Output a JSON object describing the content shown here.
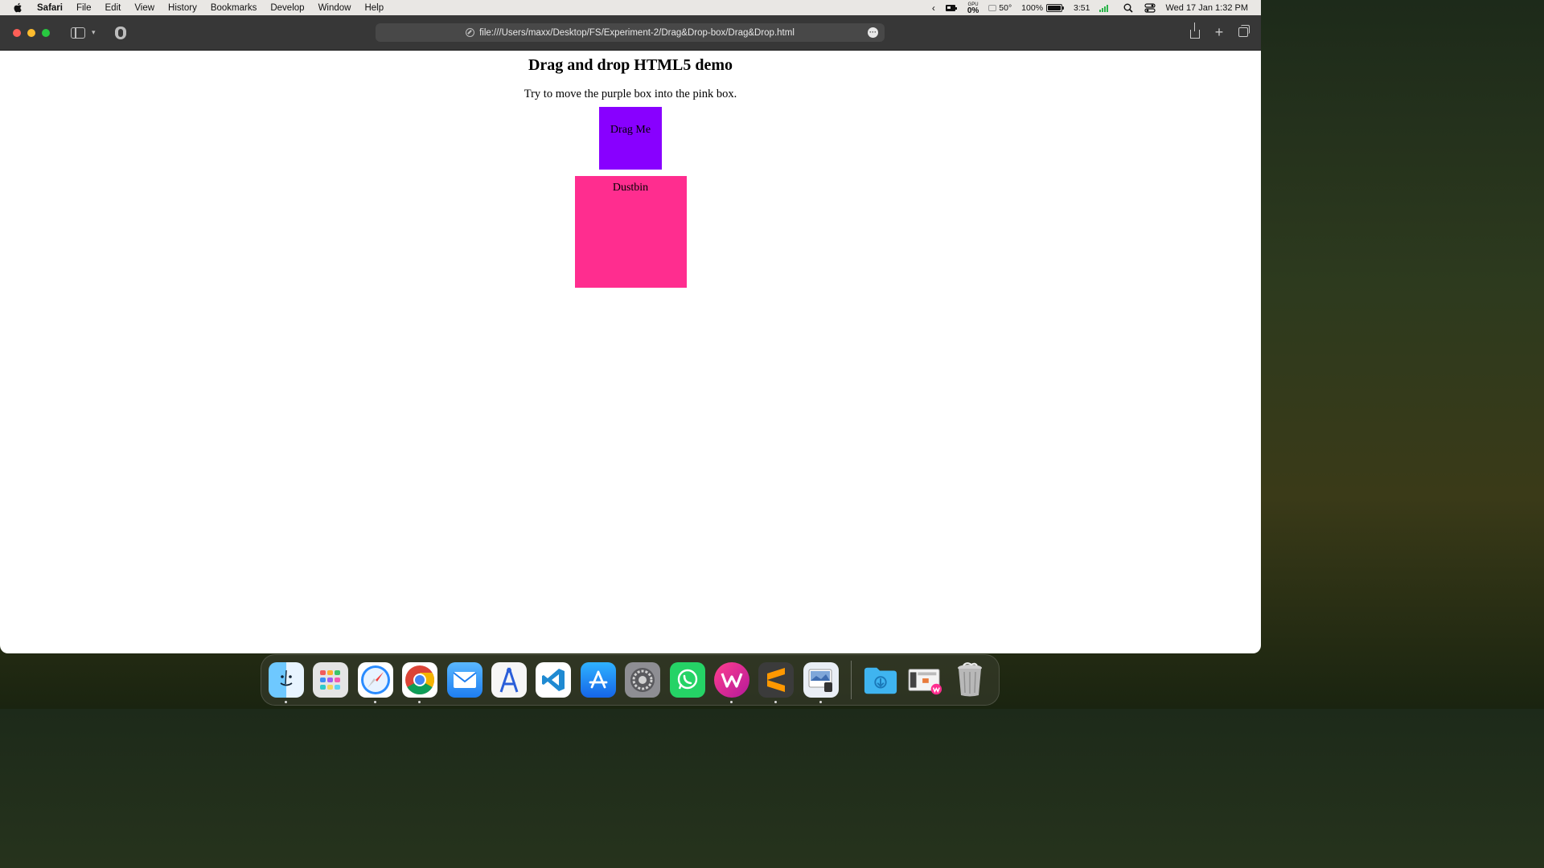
{
  "menubar": {
    "app_name": "Safari",
    "menus": [
      "File",
      "Edit",
      "View",
      "History",
      "Bookmarks",
      "Develop",
      "Window",
      "Help"
    ],
    "gpu_label": "GPU",
    "gpu_value": "0%",
    "temperature": "50°",
    "battery_percent": "100%",
    "battery_level": 1.0,
    "time_remaining": "3:51",
    "datetime": "Wed 17 Jan  1:32 PM"
  },
  "browser": {
    "url": "file:///Users/maxx/Desktop/FS/Experiment-2/Drag&Drop-box/Drag&Drop.html"
  },
  "page": {
    "title": "Drag and drop HTML5 demo",
    "instructions": "Try to move the purple box into the pink box.",
    "drag_box_label": "Drag Me",
    "drop_zone_label": "Dustbin",
    "colors": {
      "drag_box": "#8800ff",
      "drop_zone": "#ff2d8f"
    }
  },
  "dock": {
    "apps": [
      {
        "name": "finder-icon",
        "running": true
      },
      {
        "name": "launchpad-icon",
        "running": false
      },
      {
        "name": "safari-icon",
        "running": true
      },
      {
        "name": "chrome-icon",
        "running": true
      },
      {
        "name": "mail-icon",
        "running": false
      },
      {
        "name": "instruments-icon",
        "running": false
      },
      {
        "name": "vscode-icon",
        "running": false
      },
      {
        "name": "app-store-icon",
        "running": false
      },
      {
        "name": "system-settings-icon",
        "running": false
      },
      {
        "name": "whatsapp-icon",
        "running": false
      },
      {
        "name": "wps-office-icon",
        "running": true
      },
      {
        "name": "sublime-text-icon",
        "running": true
      },
      {
        "name": "preview-icon",
        "running": true
      }
    ],
    "folders": [
      "downloads-folder-icon",
      "wps-document-icon",
      "trash-icon"
    ]
  }
}
